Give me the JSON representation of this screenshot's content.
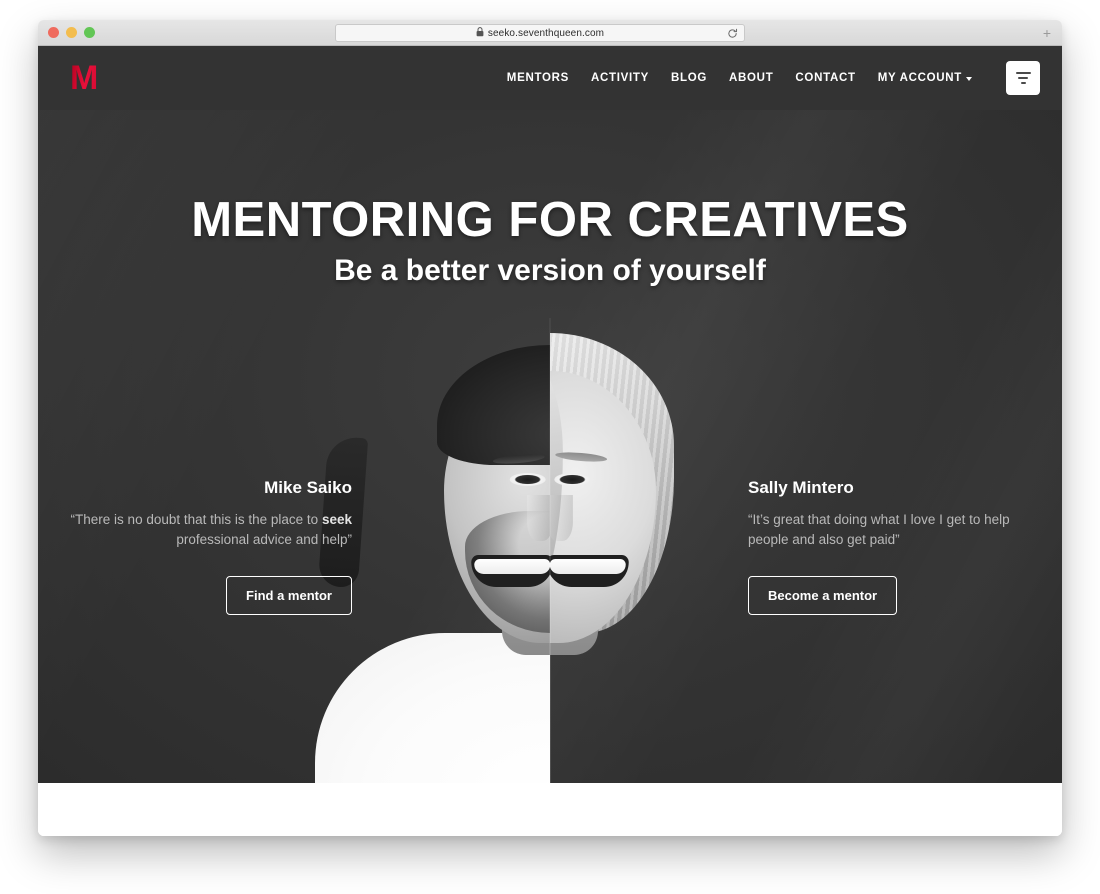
{
  "browser": {
    "url": "seeko.seventhqueen.com",
    "lock_icon": "lock-icon",
    "reload_icon": "reload-icon",
    "new_tab_label": "+",
    "traffic_lights": [
      "close",
      "minimize",
      "maximize"
    ]
  },
  "header": {
    "logo_text": "M",
    "nav": [
      {
        "label": "MENTORS"
      },
      {
        "label": "ACTIVITY"
      },
      {
        "label": "BLOG"
      },
      {
        "label": "ABOUT"
      },
      {
        "label": "CONTACT"
      },
      {
        "label": "MY ACCOUNT",
        "has_caret": true
      }
    ],
    "filter_button_icon": "filter-icon"
  },
  "hero": {
    "heading": "MENTORING FOR CREATIVES",
    "subheading": "Be a better version of yourself",
    "portrait_alt": "split-face-portrait",
    "testimonial_left": {
      "name": "Mike Saiko",
      "quote_part1": "“There is no doubt that this is the place to ",
      "quote_highlight": "seek",
      "quote_part2": " professional advice and help”",
      "button_label": "Find a mentor"
    },
    "testimonial_right": {
      "name": "Sally Mintero",
      "quote_part1": "“It’s great that doing what I love I get to help people and also get paid”",
      "quote_highlight": "",
      "quote_part2": "",
      "button_label": "Become a mentor"
    }
  },
  "colors": {
    "brand_red": "#e8103a",
    "header_bg": "#333333",
    "hero_bg": "#353535",
    "text_light": "#ffffff",
    "text_muted": "#b9b9b9"
  }
}
